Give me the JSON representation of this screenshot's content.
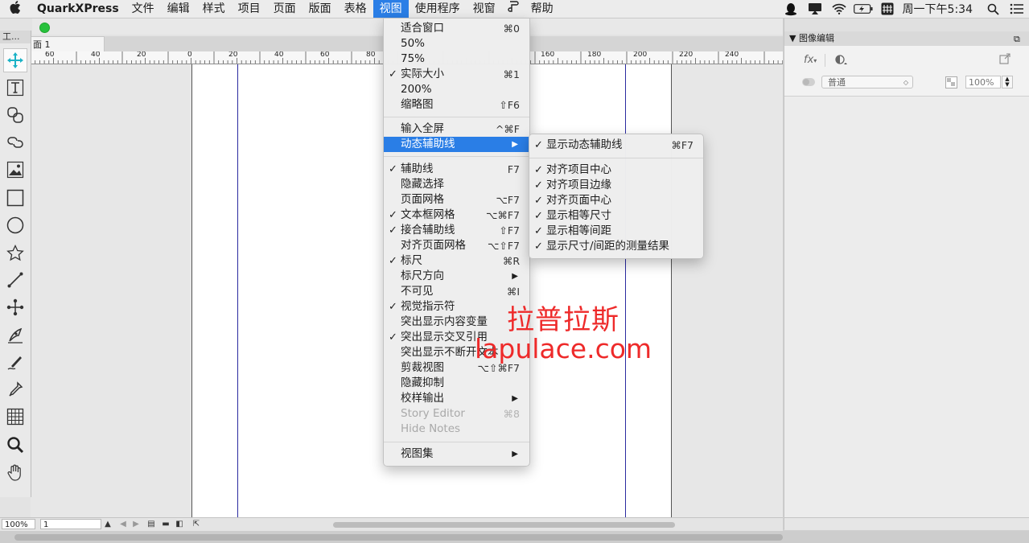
{
  "menubar": {
    "app": "QuarkXPress",
    "items": [
      "文件",
      "编辑",
      "样式",
      "项目",
      "页面",
      "版面",
      "表格",
      "视图",
      "使用程序",
      "视窗",
      "帮助"
    ],
    "active_item": "视图",
    "clock": "周一下午5:34"
  },
  "document": {
    "layout_tab": "面 1",
    "ruler_labels": [
      "60",
      "40",
      "20",
      "0",
      "20",
      "40",
      "60",
      "80",
      "160",
      "180",
      "200",
      "220",
      "240"
    ],
    "zoom": "100%",
    "page": "1"
  },
  "tools_palette": {
    "title": "工..."
  },
  "view_menu": {
    "items": [
      {
        "label": "适合窗口",
        "shortcut": "⌘0",
        "check": false
      },
      {
        "label": "50%",
        "shortcut": "",
        "check": false
      },
      {
        "label": "75%",
        "shortcut": "",
        "check": false
      },
      {
        "label": "实际大小",
        "shortcut": "⌘1",
        "check": true
      },
      {
        "label": "200%",
        "shortcut": "",
        "check": false
      },
      {
        "label": "缩略图",
        "shortcut": "⇧F6",
        "check": false
      },
      {
        "label": "输入全屏",
        "shortcut": "^⌘F",
        "check": false
      },
      {
        "label": "动态辅助线",
        "shortcut": "",
        "check": false,
        "submenu": true,
        "highlighted": true
      },
      {
        "label": "辅助线",
        "shortcut": "F7",
        "check": true
      },
      {
        "label": "隐藏选择",
        "shortcut": "",
        "check": false
      },
      {
        "label": "页面网格",
        "shortcut": "⌥F7",
        "check": false
      },
      {
        "label": "文本框网格",
        "shortcut": "⌥⌘F7",
        "check": true
      },
      {
        "label": "接合辅助线",
        "shortcut": "⇧F7",
        "check": true
      },
      {
        "label": "对齐页面网格",
        "shortcut": "⌥⇧F7",
        "check": false
      },
      {
        "label": "标尺",
        "shortcut": "⌘R",
        "check": true
      },
      {
        "label": "标尺方向",
        "shortcut": "",
        "check": false,
        "submenu": true
      },
      {
        "label": "不可见",
        "shortcut": "⌘I",
        "check": false
      },
      {
        "label": "视觉指示符",
        "shortcut": "",
        "check": true
      },
      {
        "label": "突出显示内容变量",
        "shortcut": "",
        "check": false
      },
      {
        "label": "突出显示交叉引用",
        "shortcut": "",
        "check": true
      },
      {
        "label": "突出显示不断开文本",
        "shortcut": "",
        "check": false
      },
      {
        "label": "剪裁视图",
        "shortcut": "⌥⇧⌘F7",
        "check": false
      },
      {
        "label": "隐藏抑制",
        "shortcut": "",
        "check": false
      },
      {
        "label": "校样输出",
        "shortcut": "",
        "check": false,
        "submenu": true
      },
      {
        "label": "Story Editor",
        "shortcut": "⌘8",
        "check": false,
        "disabled": true
      },
      {
        "label": "Hide Notes",
        "shortcut": "",
        "check": false,
        "disabled": true
      },
      {
        "label": "视图集",
        "shortcut": "",
        "check": false,
        "submenu": true
      }
    ]
  },
  "guides_submenu": {
    "items": [
      {
        "label": "显示动态辅助线",
        "shortcut": "⌘F7",
        "check": true
      },
      {
        "label": "对齐项目中心",
        "shortcut": "",
        "check": true
      },
      {
        "label": "对齐项目边缘",
        "shortcut": "",
        "check": true
      },
      {
        "label": "对齐页面中心",
        "shortcut": "",
        "check": true
      },
      {
        "label": "显示相等尺寸",
        "shortcut": "",
        "check": true
      },
      {
        "label": "显示相等间距",
        "shortcut": "",
        "check": true
      },
      {
        "label": "显示尺寸/间距的测量结果",
        "shortcut": "",
        "check": true
      }
    ]
  },
  "image_palette": {
    "title": "图像编辑",
    "blend_mode": "普通",
    "opacity": "100%"
  },
  "watermark": {
    "line1": "拉普拉斯",
    "line2": "lapulace.com"
  },
  "colors": {
    "accent": "#2a7ee6",
    "guide": "#2a2aa0",
    "watermark": "#ee2a2a",
    "zoom_button": "#27c13c"
  }
}
